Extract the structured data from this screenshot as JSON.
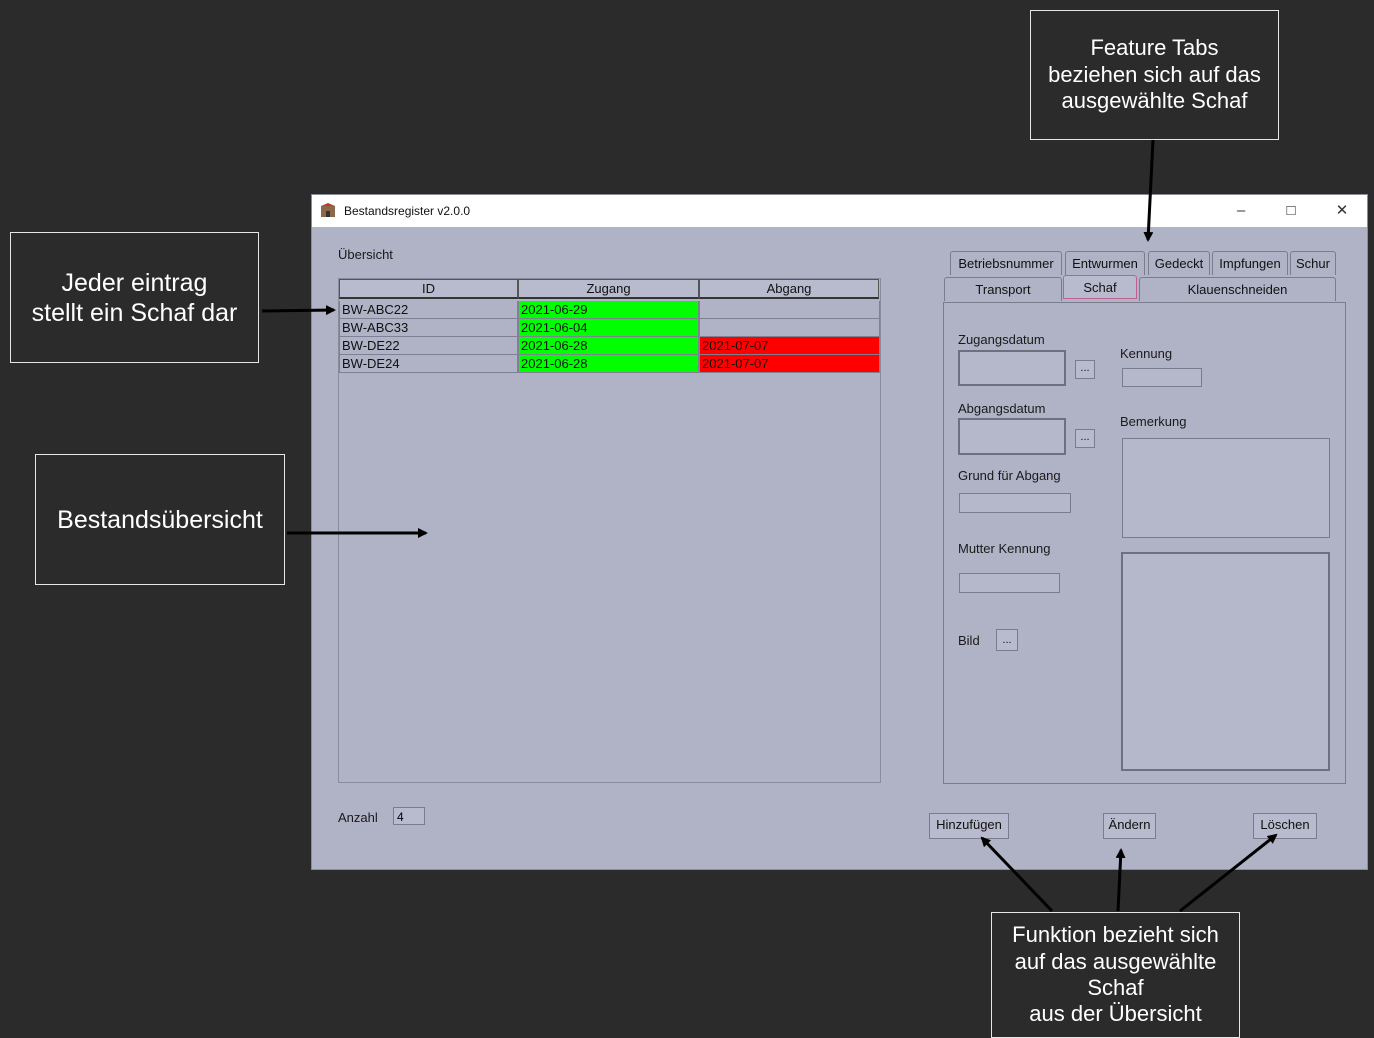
{
  "callouts": {
    "feature_tabs": "Feature Tabs\nbeziehen sich auf das\nausgewählte Schaf",
    "entry": "Jeder eintrag\nstellt ein Schaf dar",
    "overview": "Bestandsübersicht",
    "function": "Funktion bezieht sich\nauf das ausgewählte\nSchaf\naus der Übersicht"
  },
  "window": {
    "title": "Bestandsregister v2.0.0",
    "minimize": "–",
    "maximize": "□",
    "close": "✕"
  },
  "overview": {
    "label": "Übersicht",
    "columns": [
      "ID",
      "Zugang",
      "Abgang"
    ],
    "rows": [
      {
        "id": "BW-ABC22",
        "zugang": "2021-06-29",
        "abgang": ""
      },
      {
        "id": "BW-ABC33",
        "zugang": "2021-06-04",
        "abgang": ""
      },
      {
        "id": "BW-DE22",
        "zugang": "2021-06-28",
        "abgang": "2021-07-07"
      },
      {
        "id": "BW-DE24",
        "zugang": "2021-06-28",
        "abgang": "2021-07-07"
      }
    ],
    "count_label": "Anzahl",
    "count_value": "4"
  },
  "tabs": {
    "row1": [
      "Betriebsnummer",
      "Entwurmen",
      "Gedeckt",
      "Impfungen",
      "Schur"
    ],
    "row2": [
      "Transport",
      "Schaf",
      "Klauenschneiden"
    ],
    "active": "Schaf"
  },
  "form": {
    "zugangsdatum": "Zugangsdatum",
    "abgangsdatum": "Abgangsdatum",
    "grund": "Grund für Abgang",
    "mutter": "Mutter Kennung",
    "bild": "Bild",
    "kennung": "Kennung",
    "bemerkung": "Bemerkung",
    "dots": "..."
  },
  "actions": {
    "add": "Hinzufügen",
    "edit": "Ändern",
    "delete": "Löschen"
  },
  "colors": {
    "green": "#00ff00",
    "red": "#ff0000",
    "window_bg": "#b0b2c6",
    "backdrop": "#2b2b2b"
  }
}
